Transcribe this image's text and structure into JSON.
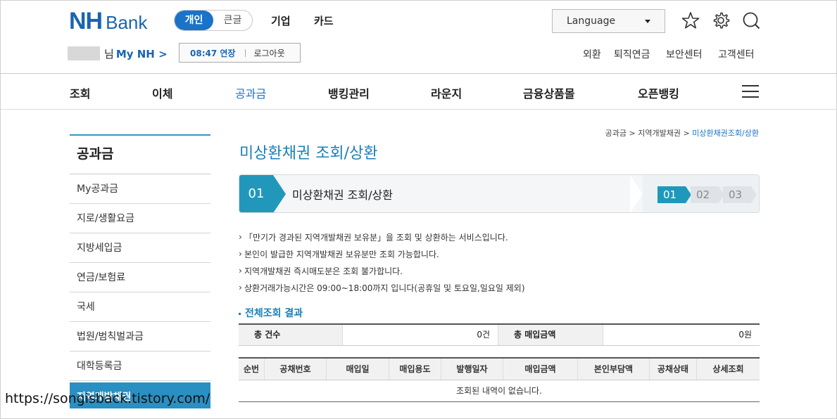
{
  "brand": {
    "nh": "NH",
    "bank": "Bank"
  },
  "segments": [
    "개인",
    "큰글"
  ],
  "top_nav": [
    "기업",
    "카드"
  ],
  "language": "Language",
  "user": {
    "suffix": "님",
    "my_nh": "My NH >"
  },
  "session": {
    "time": "08:47 연장",
    "logout": "로그아웃"
  },
  "util_links": [
    "외환",
    "퇴직연금",
    "보안센터",
    "고객센터"
  ],
  "gnb": [
    "조회",
    "이체",
    "공과금",
    "뱅킹관리",
    "라운지",
    "금융상품몰",
    "오픈뱅킹"
  ],
  "lnb": {
    "title": "공과금",
    "items": [
      "My공과금",
      "지로/생활요금",
      "지방세입금",
      "연금/보험료",
      "국세",
      "법원/범칙벌과금",
      "대학등록금",
      "지역개발채권"
    ]
  },
  "breadcrumb": {
    "a": "공과금",
    "sep1": ">",
    "b": "지역개발채권",
    "sep2": ">",
    "cur": "미상환채권조회/상환"
  },
  "page_title": "미상환채권 조회/상환",
  "step": {
    "num": "01",
    "label": "미상환채권 조회/상환",
    "steps": [
      "01",
      "02",
      "03"
    ]
  },
  "notes": [
    "「만기가 경과된 지역개발채권 보유분」을 조회 및 상환하는 서비스입니다.",
    "본인이 발급한 지역개발채권 보유분만 조회 가능합니다.",
    "지역개발채권 즉시매도분은 조회 불가합니다.",
    "상환거래가능시간은 09:00~18:00까지 입니다(공휴일 및 토요일,일요일 제외)"
  ],
  "section_title": "전체조회 결과",
  "summary": {
    "count_label": "총 건수",
    "count_value": "0건",
    "amount_label": "총 매입금액",
    "amount_value": "0원"
  },
  "table": {
    "headers": [
      "순번",
      "공채번호",
      "매입일",
      "매입용도",
      "발행일자",
      "매입금액",
      "본인부담액",
      "공채상태",
      "상세조회"
    ],
    "empty": "조회된 내역이 없습니다."
  },
  "watermark": "https://songisback.tistory.com/"
}
